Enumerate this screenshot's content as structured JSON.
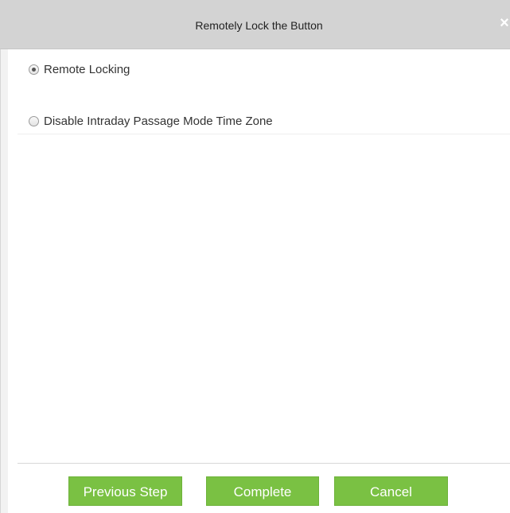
{
  "dialog": {
    "title": "Remotely Lock the Button",
    "close_icon": "close-icon",
    "close_glyph": "×"
  },
  "options": [
    {
      "label": "Remote Locking",
      "selected": true
    },
    {
      "label": "Disable Intraday Passage Mode Time Zone",
      "selected": false
    }
  ],
  "buttons": {
    "previous_label": "Previous Step",
    "complete_label": "Complete",
    "cancel_label": "Cancel"
  },
  "colors": {
    "button_green": "#7ac143",
    "titlebar": "#d3d3d3"
  }
}
